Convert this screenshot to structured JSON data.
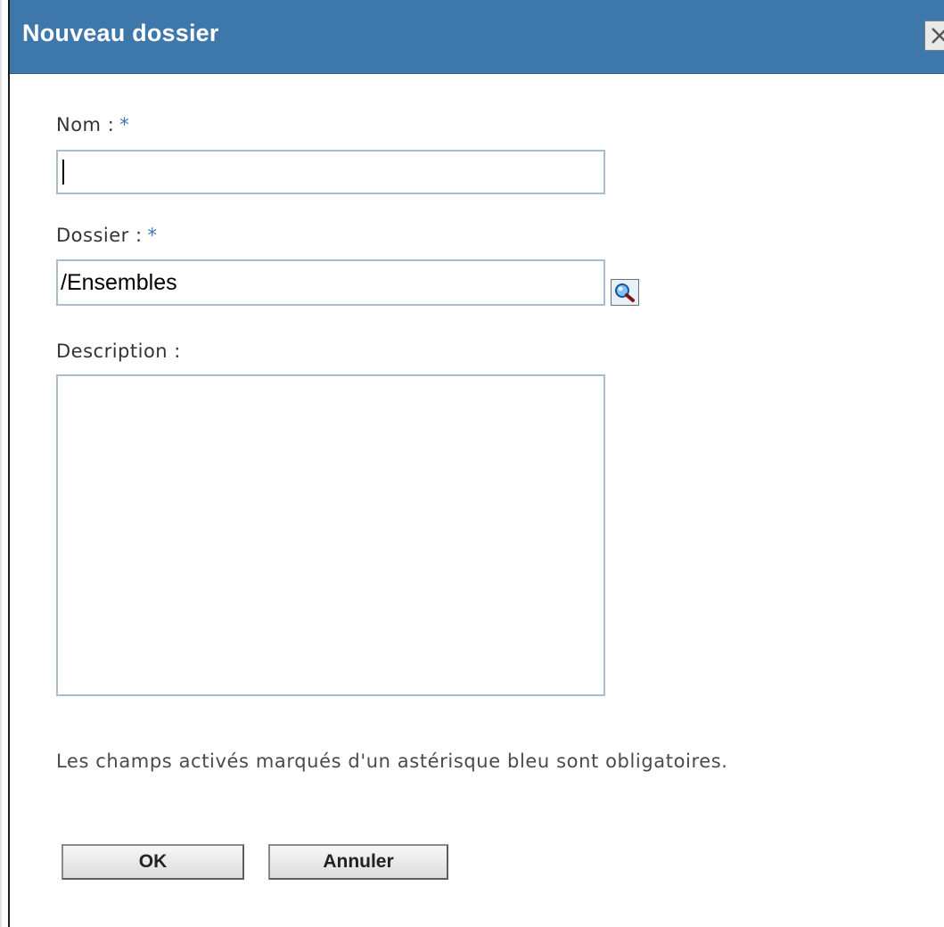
{
  "dialog": {
    "title": "Nouveau dossier",
    "close_icon": "close-icon"
  },
  "form": {
    "name": {
      "label": "Nom :",
      "required_mark": "*",
      "value": ""
    },
    "folder": {
      "label": "Dossier :",
      "required_mark": "*",
      "value": "/Ensembles",
      "browse_icon": "magnifier-icon"
    },
    "description": {
      "label": "Description :",
      "value": ""
    },
    "note": "Les champs activés marqués d'un astérisque bleu sont obligatoires."
  },
  "buttons": {
    "ok": "OK",
    "cancel": "Annuler"
  },
  "colors": {
    "titlebar": "#3e78ab",
    "required": "#3a78b5",
    "field_border": "#a9bdd0"
  }
}
